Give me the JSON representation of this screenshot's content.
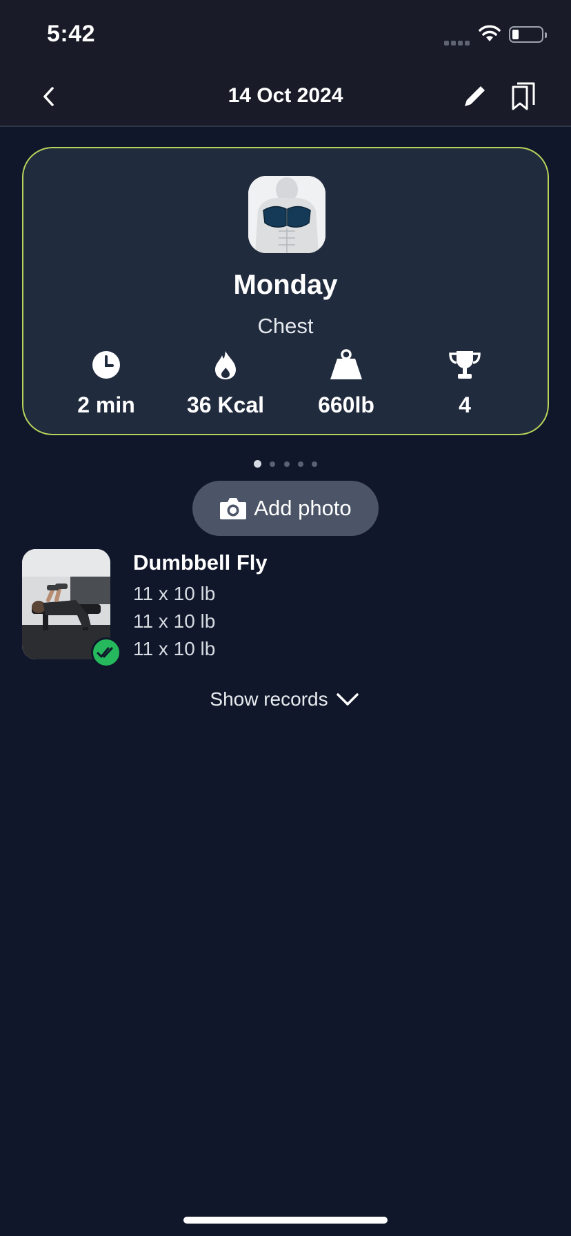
{
  "status_bar": {
    "time": "5:42"
  },
  "header": {
    "title": "14 Oct 2024",
    "back_icon": "chevron-left-icon",
    "edit_icon": "pencil-icon",
    "bookmark_icon": "bookmark-icon"
  },
  "summary": {
    "day": "Monday",
    "muscle_group": "Chest",
    "stats": [
      {
        "icon": "clock-icon",
        "value": "2 min"
      },
      {
        "icon": "flame-icon",
        "value": "36 Kcal"
      },
      {
        "icon": "weight-icon",
        "value": "660lb"
      },
      {
        "icon": "trophy-icon",
        "value": "4"
      }
    ],
    "accent_color": "#b8d45a"
  },
  "pager": {
    "count": 5,
    "active_index": 0
  },
  "add_photo": {
    "label": "Add photo"
  },
  "exercise": {
    "name": "Dumbbell Fly",
    "sets": [
      "11 x 10 lb",
      "11 x 10 lb",
      "11 x 10 lb"
    ],
    "completed": true
  },
  "show_records": {
    "label": "Show records"
  }
}
